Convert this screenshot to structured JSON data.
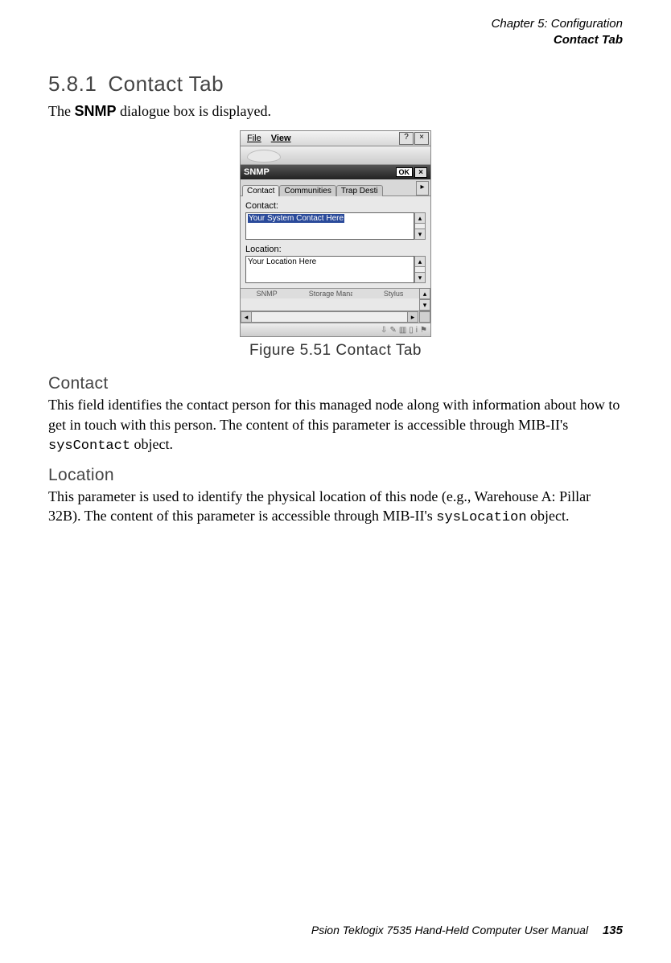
{
  "header": {
    "chapter": "Chapter 5: Configuration",
    "section": "Contact Tab"
  },
  "section_heading": {
    "number": "5.8.1",
    "title": "Contact Tab"
  },
  "intro": {
    "pre": "The ",
    "bold": "SNMP",
    "post": " dialogue box is displayed."
  },
  "figure": {
    "menubar": {
      "file": "File",
      "view": "View",
      "help": "?",
      "close": "×"
    },
    "titlebar": {
      "title": "SNMP",
      "ok": "OK",
      "close": "×"
    },
    "tabs": {
      "contact": "Contact",
      "communities": "Communities",
      "trap": "Trap Desti",
      "nav": "▸"
    },
    "panel": {
      "contact_label": "Contact:",
      "contact_value": "Your System Contact Here",
      "location_label": "Location:",
      "location_value": "Your Location Here"
    },
    "desktop_icons": {
      "snmp": "SNMP",
      "storage": "Storage Manager",
      "stylus": "Stylus"
    },
    "scroll": {
      "up": "▴",
      "down": "▾",
      "left": "◂",
      "right": "▸"
    },
    "status": {
      "i1": "⇩",
      "i2": "✎",
      "i3": "▥",
      "i4": "▯",
      "i5": "i",
      "i6": "⚑"
    },
    "caption": "Figure 5.51 Contact Tab"
  },
  "sub_contact": {
    "heading": "Contact",
    "body_pre": "This field identifies the contact person for this managed node along with information about how to get in touch with this person. The content of this parameter is accessible through MIB-II's ",
    "code": "sysContact",
    "body_post": " object."
  },
  "sub_location": {
    "heading": "Location",
    "body_pre": "This parameter is used to identify the physical location of this node (e.g., Warehouse A: Pillar 32B). The content of this parameter is accessible through MIB-II's ",
    "code": "sysLocation",
    "body_post": " object."
  },
  "footer": {
    "text": "Psion Teklogix 7535 Hand-Held Computer User Manual",
    "page": "135"
  }
}
